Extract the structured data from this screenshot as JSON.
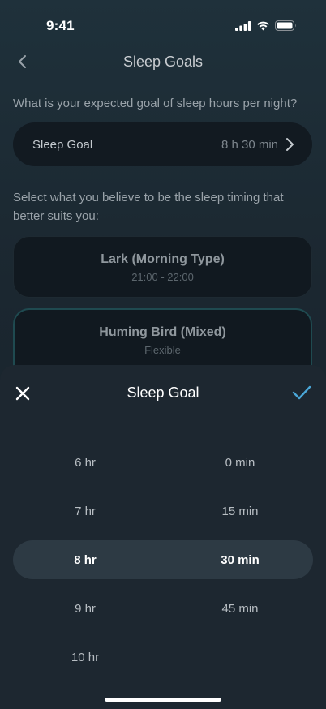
{
  "status_bar": {
    "time": "9:41"
  },
  "header": {
    "title": "Sleep Goals"
  },
  "question": "What is your expected goal of sleep hours per night?",
  "goal_row": {
    "label": "Sleep Goal",
    "value": "8 h 30 min"
  },
  "timing_question": "Select what you believe to be the sleep timing that better suits you:",
  "timing_options": [
    {
      "title": "Lark (Morning Type)",
      "subtitle": "21:00 - 22:00"
    },
    {
      "title": "Huming Bird (Mixed)",
      "subtitle": "Flexible"
    }
  ],
  "sheet": {
    "title": "Sleep Goal",
    "hours": [
      "6 hr",
      "7 hr",
      "8 hr",
      "9 hr",
      "10 hr"
    ],
    "minutes": [
      "0 min",
      "15 min",
      "30 min",
      "45 min"
    ],
    "selected_hours": "8 hr",
    "selected_minutes": "30 min"
  },
  "colors": {
    "accent": "#4aa7d8",
    "selected_border": "#1f4a50"
  }
}
